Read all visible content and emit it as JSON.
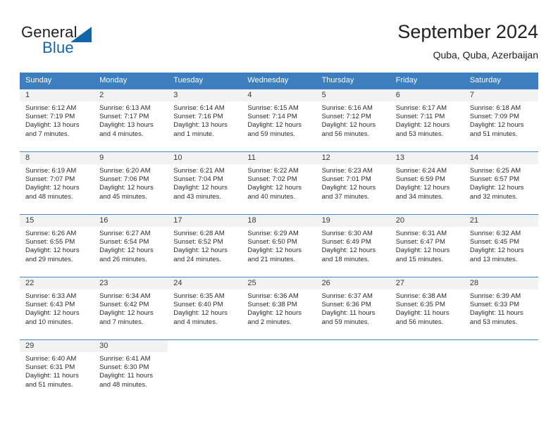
{
  "brand": {
    "name_part1": "General",
    "name_part2": "Blue",
    "logo_icon": "triangle-icon",
    "colors": {
      "blue": "#1464aa",
      "dark": "#231f20"
    }
  },
  "header": {
    "title": "September 2024",
    "subtitle": "Quba, Quba, Azerbaijan"
  },
  "calendar": {
    "header_background": "#3d7ebf",
    "daynum_background": "#f2f2f2",
    "row_border_color": "#4a87c4",
    "weekday_headers": [
      "Sunday",
      "Monday",
      "Tuesday",
      "Wednesday",
      "Thursday",
      "Friday",
      "Saturday"
    ],
    "weeks": [
      [
        {
          "day": "1",
          "sunrise": "Sunrise: 6:12 AM",
          "sunset": "Sunset: 7:19 PM",
          "daylight_line1": "Daylight: 13 hours",
          "daylight_line2": "and 7 minutes."
        },
        {
          "day": "2",
          "sunrise": "Sunrise: 6:13 AM",
          "sunset": "Sunset: 7:17 PM",
          "daylight_line1": "Daylight: 13 hours",
          "daylight_line2": "and 4 minutes."
        },
        {
          "day": "3",
          "sunrise": "Sunrise: 6:14 AM",
          "sunset": "Sunset: 7:16 PM",
          "daylight_line1": "Daylight: 13 hours",
          "daylight_line2": "and 1 minute."
        },
        {
          "day": "4",
          "sunrise": "Sunrise: 6:15 AM",
          "sunset": "Sunset: 7:14 PM",
          "daylight_line1": "Daylight: 12 hours",
          "daylight_line2": "and 59 minutes."
        },
        {
          "day": "5",
          "sunrise": "Sunrise: 6:16 AM",
          "sunset": "Sunset: 7:12 PM",
          "daylight_line1": "Daylight: 12 hours",
          "daylight_line2": "and 56 minutes."
        },
        {
          "day": "6",
          "sunrise": "Sunrise: 6:17 AM",
          "sunset": "Sunset: 7:11 PM",
          "daylight_line1": "Daylight: 12 hours",
          "daylight_line2": "and 53 minutes."
        },
        {
          "day": "7",
          "sunrise": "Sunrise: 6:18 AM",
          "sunset": "Sunset: 7:09 PM",
          "daylight_line1": "Daylight: 12 hours",
          "daylight_line2": "and 51 minutes."
        }
      ],
      [
        {
          "day": "8",
          "sunrise": "Sunrise: 6:19 AM",
          "sunset": "Sunset: 7:07 PM",
          "daylight_line1": "Daylight: 12 hours",
          "daylight_line2": "and 48 minutes."
        },
        {
          "day": "9",
          "sunrise": "Sunrise: 6:20 AM",
          "sunset": "Sunset: 7:06 PM",
          "daylight_line1": "Daylight: 12 hours",
          "daylight_line2": "and 45 minutes."
        },
        {
          "day": "10",
          "sunrise": "Sunrise: 6:21 AM",
          "sunset": "Sunset: 7:04 PM",
          "daylight_line1": "Daylight: 12 hours",
          "daylight_line2": "and 43 minutes."
        },
        {
          "day": "11",
          "sunrise": "Sunrise: 6:22 AM",
          "sunset": "Sunset: 7:02 PM",
          "daylight_line1": "Daylight: 12 hours",
          "daylight_line2": "and 40 minutes."
        },
        {
          "day": "12",
          "sunrise": "Sunrise: 6:23 AM",
          "sunset": "Sunset: 7:01 PM",
          "daylight_line1": "Daylight: 12 hours",
          "daylight_line2": "and 37 minutes."
        },
        {
          "day": "13",
          "sunrise": "Sunrise: 6:24 AM",
          "sunset": "Sunset: 6:59 PM",
          "daylight_line1": "Daylight: 12 hours",
          "daylight_line2": "and 34 minutes."
        },
        {
          "day": "14",
          "sunrise": "Sunrise: 6:25 AM",
          "sunset": "Sunset: 6:57 PM",
          "daylight_line1": "Daylight: 12 hours",
          "daylight_line2": "and 32 minutes."
        }
      ],
      [
        {
          "day": "15",
          "sunrise": "Sunrise: 6:26 AM",
          "sunset": "Sunset: 6:55 PM",
          "daylight_line1": "Daylight: 12 hours",
          "daylight_line2": "and 29 minutes."
        },
        {
          "day": "16",
          "sunrise": "Sunrise: 6:27 AM",
          "sunset": "Sunset: 6:54 PM",
          "daylight_line1": "Daylight: 12 hours",
          "daylight_line2": "and 26 minutes."
        },
        {
          "day": "17",
          "sunrise": "Sunrise: 6:28 AM",
          "sunset": "Sunset: 6:52 PM",
          "daylight_line1": "Daylight: 12 hours",
          "daylight_line2": "and 24 minutes."
        },
        {
          "day": "18",
          "sunrise": "Sunrise: 6:29 AM",
          "sunset": "Sunset: 6:50 PM",
          "daylight_line1": "Daylight: 12 hours",
          "daylight_line2": "and 21 minutes."
        },
        {
          "day": "19",
          "sunrise": "Sunrise: 6:30 AM",
          "sunset": "Sunset: 6:49 PM",
          "daylight_line1": "Daylight: 12 hours",
          "daylight_line2": "and 18 minutes."
        },
        {
          "day": "20",
          "sunrise": "Sunrise: 6:31 AM",
          "sunset": "Sunset: 6:47 PM",
          "daylight_line1": "Daylight: 12 hours",
          "daylight_line2": "and 15 minutes."
        },
        {
          "day": "21",
          "sunrise": "Sunrise: 6:32 AM",
          "sunset": "Sunset: 6:45 PM",
          "daylight_line1": "Daylight: 12 hours",
          "daylight_line2": "and 13 minutes."
        }
      ],
      [
        {
          "day": "22",
          "sunrise": "Sunrise: 6:33 AM",
          "sunset": "Sunset: 6:43 PM",
          "daylight_line1": "Daylight: 12 hours",
          "daylight_line2": "and 10 minutes."
        },
        {
          "day": "23",
          "sunrise": "Sunrise: 6:34 AM",
          "sunset": "Sunset: 6:42 PM",
          "daylight_line1": "Daylight: 12 hours",
          "daylight_line2": "and 7 minutes."
        },
        {
          "day": "24",
          "sunrise": "Sunrise: 6:35 AM",
          "sunset": "Sunset: 6:40 PM",
          "daylight_line1": "Daylight: 12 hours",
          "daylight_line2": "and 4 minutes."
        },
        {
          "day": "25",
          "sunrise": "Sunrise: 6:36 AM",
          "sunset": "Sunset: 6:38 PM",
          "daylight_line1": "Daylight: 12 hours",
          "daylight_line2": "and 2 minutes."
        },
        {
          "day": "26",
          "sunrise": "Sunrise: 6:37 AM",
          "sunset": "Sunset: 6:36 PM",
          "daylight_line1": "Daylight: 11 hours",
          "daylight_line2": "and 59 minutes."
        },
        {
          "day": "27",
          "sunrise": "Sunrise: 6:38 AM",
          "sunset": "Sunset: 6:35 PM",
          "daylight_line1": "Daylight: 11 hours",
          "daylight_line2": "and 56 minutes."
        },
        {
          "day": "28",
          "sunrise": "Sunrise: 6:39 AM",
          "sunset": "Sunset: 6:33 PM",
          "daylight_line1": "Daylight: 11 hours",
          "daylight_line2": "and 53 minutes."
        }
      ],
      [
        {
          "day": "29",
          "sunrise": "Sunrise: 6:40 AM",
          "sunset": "Sunset: 6:31 PM",
          "daylight_line1": "Daylight: 11 hours",
          "daylight_line2": "and 51 minutes."
        },
        {
          "day": "30",
          "sunrise": "Sunrise: 6:41 AM",
          "sunset": "Sunset: 6:30 PM",
          "daylight_line1": "Daylight: 11 hours",
          "daylight_line2": "and 48 minutes."
        },
        {
          "day": "",
          "sunrise": "",
          "sunset": "",
          "daylight_line1": "",
          "daylight_line2": ""
        },
        {
          "day": "",
          "sunrise": "",
          "sunset": "",
          "daylight_line1": "",
          "daylight_line2": ""
        },
        {
          "day": "",
          "sunrise": "",
          "sunset": "",
          "daylight_line1": "",
          "daylight_line2": ""
        },
        {
          "day": "",
          "sunrise": "",
          "sunset": "",
          "daylight_line1": "",
          "daylight_line2": ""
        },
        {
          "day": "",
          "sunrise": "",
          "sunset": "",
          "daylight_line1": "",
          "daylight_line2": ""
        }
      ]
    ]
  }
}
